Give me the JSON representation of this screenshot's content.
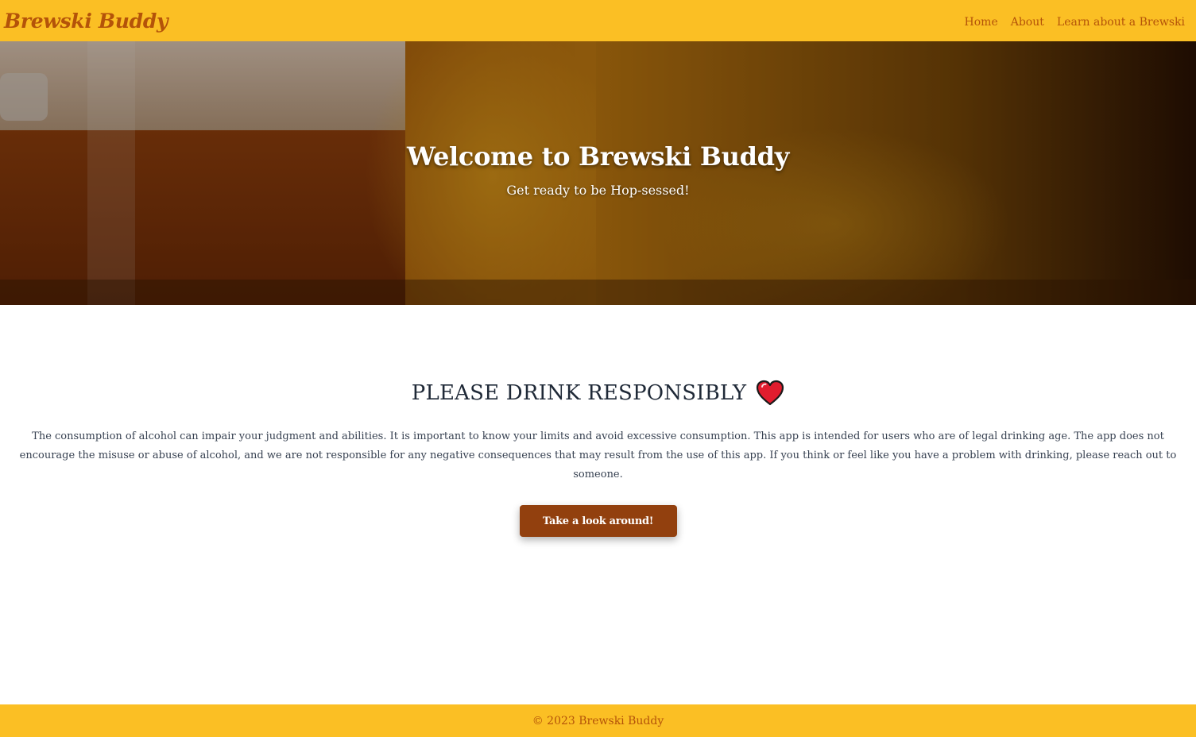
{
  "navbar": {
    "brand": "Brewski Buddy",
    "links": [
      {
        "label": "Home"
      },
      {
        "label": "About"
      },
      {
        "label": "Learn about a Brewski"
      }
    ]
  },
  "hero": {
    "title": "Welcome to Brewski Buddy",
    "subtitle": "Get ready to be Hop-sessed!",
    "background": "beer-glass-photo"
  },
  "main": {
    "heading": "PLEASE DRINK RESPONSIBLY",
    "heading_icon": "heart-icon",
    "disclaimer": "The consumption of alcohol can impair your judgment and abilities. It is important to know your limits and avoid excessive consumption. This app is intended for users who are of legal drinking age. The app does not encourage the misuse or abuse of alcohol, and we are not responsible for any negative consequences that may result from the use of this app. If you think or feel like you have a problem with drinking, please reach out to someone.",
    "cta_label": "Take a look around!"
  },
  "footer": {
    "text": "© 2023 Brewski Buddy"
  },
  "colors": {
    "navbar_bg": "#fbbf24",
    "brand": "#b45309",
    "cta_bg": "#92400e",
    "heading": "#1f2937",
    "heart": "#e11d2e"
  }
}
